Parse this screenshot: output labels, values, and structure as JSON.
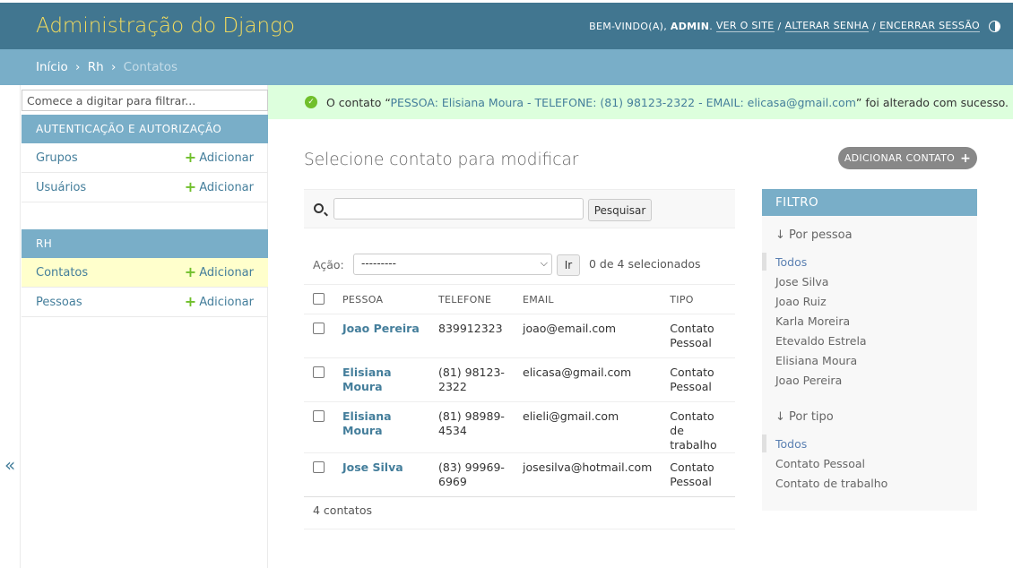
{
  "header": {
    "brand": "Administração do Django",
    "welcome": "BEM-VINDO(A),",
    "user": "ADMIN",
    "view_site": "VER O SITE",
    "change_password": "ALTERAR SENHA",
    "logout": "ENCERRAR SESSÃO",
    "sep": "/"
  },
  "breadcrumbs": {
    "home": "Início",
    "app": "Rh",
    "current": "Contatos",
    "sep": "›"
  },
  "sidebar": {
    "filter_placeholder": "Comece a digitar para filtrar...",
    "modules": [
      {
        "caption": "AUTENTICAÇÃO E AUTORIZAÇÃO",
        "models": [
          {
            "name": "Grupos",
            "add": "Adicionar"
          },
          {
            "name": "Usuários",
            "add": "Adicionar"
          }
        ]
      },
      {
        "caption": "RH",
        "models": [
          {
            "name": "Contatos",
            "add": "Adicionar"
          },
          {
            "name": "Pessoas",
            "add": "Adicionar"
          }
        ]
      }
    ],
    "collapse": "«"
  },
  "message": {
    "prefix": "O contato “",
    "object": "PESSOA: Elisiana Moura - TELEFONE: (81) 98123-2322 - EMAIL: elicasa@gmail.com",
    "suffix": "” foi alterado com sucesso."
  },
  "content": {
    "title": "Selecione contato para modificar",
    "add_button": "ADICIONAR CONTATO",
    "search_button": "Pesquisar",
    "action_label": "Ação:",
    "action_selected": "---------",
    "go_button": "Ir",
    "selection_count": "0 de 4 selecionados",
    "columns": [
      "PESSOA",
      "TELEFONE",
      "EMAIL",
      "TIPO"
    ],
    "rows": [
      {
        "pessoa": "Joao Pereira",
        "telefone": "839912323",
        "email": "joao@email.com",
        "tipo": "Contato Pessoal"
      },
      {
        "pessoa": "Elisiana Moura",
        "telefone": "(81) 98123-2322",
        "email": "elicasa@gmail.com",
        "tipo": "Contato Pessoal"
      },
      {
        "pessoa": "Elisiana Moura",
        "telefone": "(81) 98989-4534",
        "email": "elieli@gmail.com",
        "tipo": "Contato de trabalho"
      },
      {
        "pessoa": "Jose Silva",
        "telefone": "(83) 99969-6969",
        "email": "josesilva@hotmail.com",
        "tipo": "Contato Pessoal"
      }
    ],
    "paginator": "4 contatos"
  },
  "filter": {
    "title": "FILTRO",
    "groups": [
      {
        "title": "↓ Por pessoa",
        "items": [
          "Todos",
          "Jose Silva",
          "Joao Ruiz",
          "Karla Moreira",
          "Etevaldo Estrela",
          "Elisiana Moura",
          "Joao Pereira"
        ]
      },
      {
        "title": "↓ Por tipo",
        "items": [
          "Todos",
          "Contato Pessoal",
          "Contato de trabalho"
        ]
      }
    ]
  },
  "colors": {
    "header_bg": "#417690",
    "brand": "#f5dd5d",
    "breadcrumb_bg": "#79aec8",
    "link": "#447e9b",
    "success_bg": "#ddffdd",
    "add_green": "#70bf2b",
    "current_row": "#ffffcc"
  },
  "icons": [
    "theme-toggle-icon",
    "success-check-icon",
    "search-icon",
    "plus-icon",
    "chevron-down-icon",
    "collapse-icon"
  ]
}
